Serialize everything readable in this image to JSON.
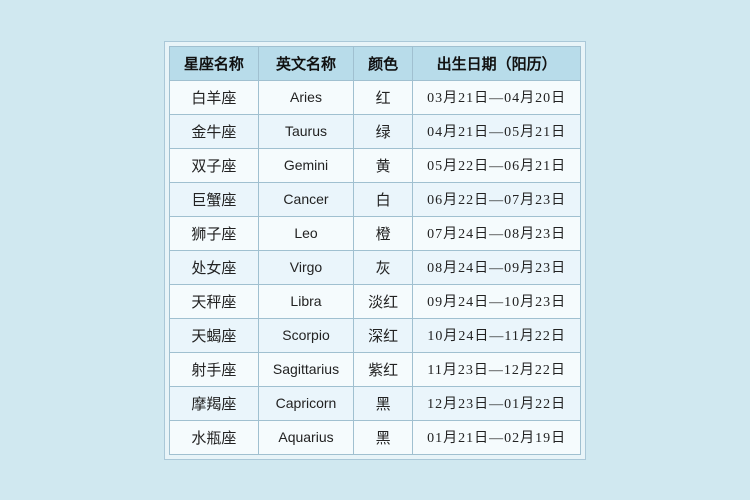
{
  "table": {
    "headers": [
      {
        "key": "zh_name",
        "label": "星座名称"
      },
      {
        "key": "en_name",
        "label": "英文名称"
      },
      {
        "key": "color",
        "label": "颜色"
      },
      {
        "key": "date_range",
        "label": "出生日期（阳历）"
      }
    ],
    "rows": [
      {
        "zh_name": "白羊座",
        "en_name": "Aries",
        "color": "红",
        "date_range": "03月21日—04月20日"
      },
      {
        "zh_name": "金牛座",
        "en_name": "Taurus",
        "color": "绿",
        "date_range": "04月21日—05月21日"
      },
      {
        "zh_name": "双子座",
        "en_name": "Gemini",
        "color": "黄",
        "date_range": "05月22日—06月21日"
      },
      {
        "zh_name": "巨蟹座",
        "en_name": "Cancer",
        "color": "白",
        "date_range": "06月22日—07月23日"
      },
      {
        "zh_name": "狮子座",
        "en_name": "Leo",
        "color": "橙",
        "date_range": "07月24日—08月23日"
      },
      {
        "zh_name": "处女座",
        "en_name": "Virgo",
        "color": "灰",
        "date_range": "08月24日—09月23日"
      },
      {
        "zh_name": "天秤座",
        "en_name": "Libra",
        "color": "淡红",
        "date_range": "09月24日—10月23日"
      },
      {
        "zh_name": "天蝎座",
        "en_name": "Scorpio",
        "color": "深红",
        "date_range": "10月24日—11月22日"
      },
      {
        "zh_name": "射手座",
        "en_name": "Sagittarius",
        "color": "紫红",
        "date_range": "11月23日—12月22日"
      },
      {
        "zh_name": "摩羯座",
        "en_name": "Capricorn",
        "color": "黑",
        "date_range": "12月23日—01月22日"
      },
      {
        "zh_name": "水瓶座",
        "en_name": "Aquarius",
        "color": "黑",
        "date_range": "01月21日—02月19日"
      }
    ]
  }
}
